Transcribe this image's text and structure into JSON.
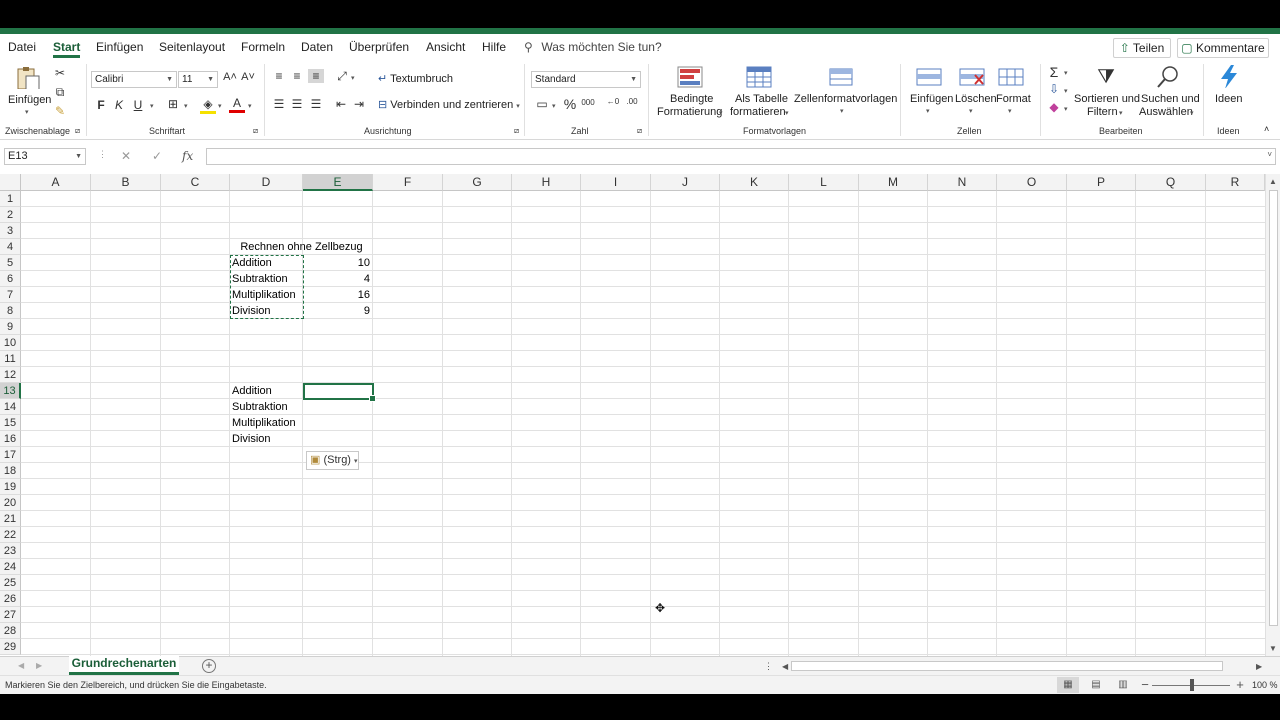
{
  "ribbon_tabs": [
    "Datei",
    "Start",
    "Einfügen",
    "Seitenlayout",
    "Formeln",
    "Daten",
    "Überprüfen",
    "Ansicht",
    "Hilfe"
  ],
  "active_tab": "Start",
  "tell_me": "Was möchten Sie tun?",
  "share_label": "Teilen",
  "comments_label": "Kommentare",
  "clipboard": {
    "paste_label": "Einfügen",
    "group_label": "Zwischenablage"
  },
  "font": {
    "name": "Calibri",
    "size": "11",
    "bold": "F",
    "italic": "K",
    "underline": "U",
    "group_label": "Schriftart"
  },
  "alignment": {
    "wrap_text": "Textumbruch",
    "merge_center": "Verbinden und zentrieren",
    "group_label": "Ausrichtung"
  },
  "number": {
    "format": "Standard",
    "group_label": "Zahl"
  },
  "styles": {
    "conditional_1": "Bedingte",
    "conditional_2": "Formatierung",
    "as_table_1": "Als Tabelle",
    "as_table_2": "formatieren",
    "cell_styles": "Zellenformatvorlagen",
    "group_label": "Formatvorlagen"
  },
  "cells": {
    "insert": "Einfügen",
    "delete": "Löschen",
    "format": "Format",
    "group_label": "Zellen"
  },
  "editing": {
    "sort_1": "Sortieren und",
    "sort_2": "Filtern",
    "find_1": "Suchen und",
    "find_2": "Auswählen",
    "group_label": "Bearbeiten"
  },
  "ideas": {
    "label": "Ideen",
    "group_label": "Ideen"
  },
  "name_box": "E13",
  "fx_label": "fx",
  "columns": [
    "A",
    "B",
    "C",
    "D",
    "E",
    "F",
    "G",
    "H",
    "I",
    "J",
    "K",
    "L",
    "M",
    "N",
    "O",
    "P",
    "Q",
    "R"
  ],
  "rows": [
    "1",
    "2",
    "3",
    "4",
    "5",
    "6",
    "7",
    "8",
    "9",
    "10",
    "11",
    "12",
    "13",
    "14",
    "15",
    "16",
    "17",
    "18",
    "19",
    "20",
    "21",
    "22",
    "23",
    "24",
    "25",
    "26",
    "27",
    "28",
    "29"
  ],
  "sheet": {
    "title": "Rechnen ohne Zellbezug",
    "table1": [
      {
        "label": "Addition",
        "value": "10"
      },
      {
        "label": "Subtraktion",
        "value": "4"
      },
      {
        "label": "Multiplikation",
        "value": "16"
      },
      {
        "label": "Division",
        "value": "9"
      }
    ],
    "table2": [
      "Addition",
      "Subtraktion",
      "Multiplikation",
      "Division"
    ],
    "paste_options": "(Strg)"
  },
  "sheet_tab": "Grundrechenarten",
  "status_message": "Markieren Sie den Zielbereich, und drücken Sie die Eingabetaste.",
  "zoom_label": "100 %"
}
